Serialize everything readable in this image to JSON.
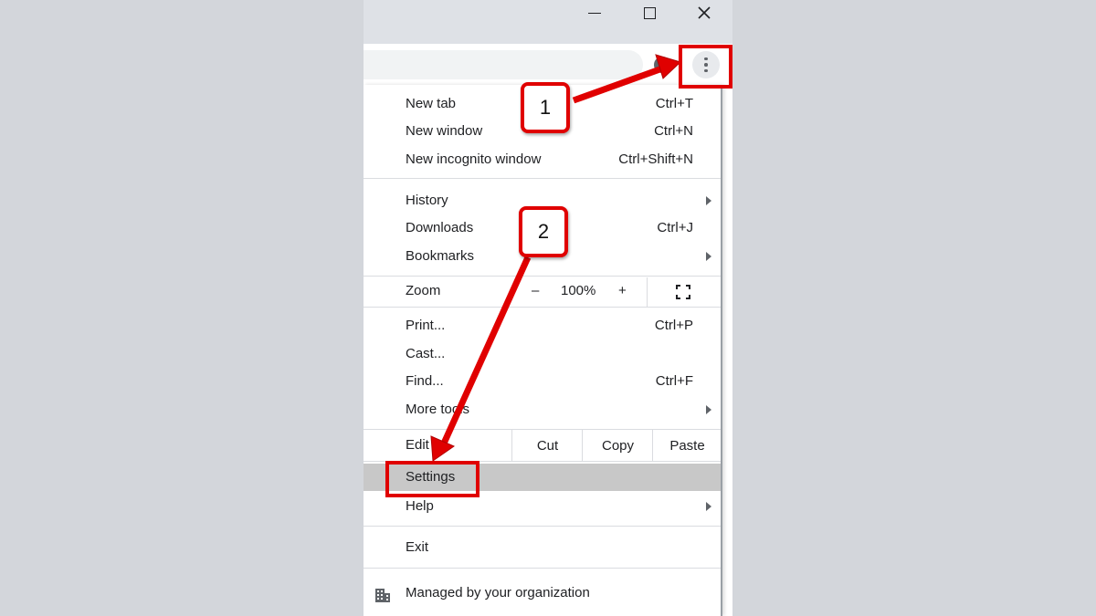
{
  "window": {
    "controls": [
      "minimize",
      "maximize",
      "close"
    ]
  },
  "menu": {
    "section1": [
      {
        "label": "New tab",
        "shortcut": "Ctrl+T"
      },
      {
        "label": "New window",
        "shortcut": "Ctrl+N"
      },
      {
        "label": "New incognito window",
        "shortcut": "Ctrl+Shift+N"
      }
    ],
    "section2": [
      {
        "label": "History",
        "shortcut": ""
      },
      {
        "label": "Downloads",
        "shortcut": "Ctrl+J"
      },
      {
        "label": "Bookmarks",
        "shortcut": ""
      }
    ],
    "zoom": {
      "label": "Zoom",
      "minus": "–",
      "value": "100%",
      "plus": "+"
    },
    "section3": [
      {
        "label": "Print...",
        "shortcut": "Ctrl+P"
      },
      {
        "label": "Cast...",
        "shortcut": ""
      },
      {
        "label": "Find...",
        "shortcut": "Ctrl+F"
      },
      {
        "label": "More tools",
        "shortcut": ""
      }
    ],
    "edit": {
      "label": "Edit",
      "cut": "Cut",
      "copy": "Copy",
      "paste": "Paste"
    },
    "settings": {
      "label": "Settings"
    },
    "help": {
      "label": "Help"
    },
    "exit": {
      "label": "Exit"
    },
    "managed": {
      "label": "Managed by your organization"
    }
  },
  "annotations": {
    "step1": "1",
    "step2": "2",
    "accent_color": "#e00000"
  }
}
